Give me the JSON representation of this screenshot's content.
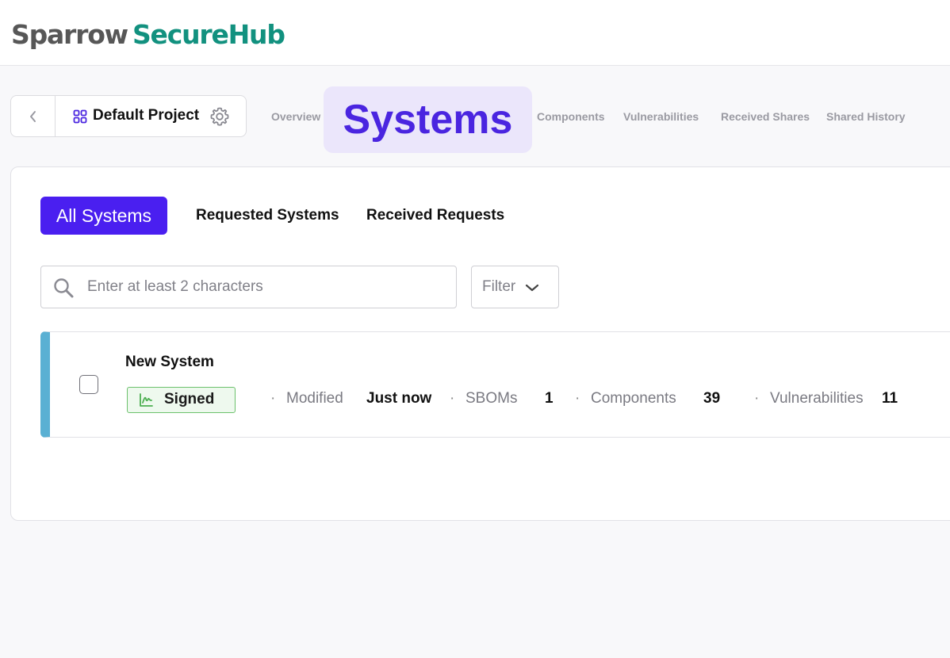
{
  "header": {
    "brand": "Sparrow",
    "product": "SecureHub"
  },
  "project": {
    "name": "Default Project"
  },
  "nav": {
    "tabs": [
      {
        "label": "Overview"
      },
      {
        "label": "Systems",
        "active": true
      },
      {
        "label": "Components"
      },
      {
        "label": "Vulnerabilities"
      },
      {
        "label": "Received Shares"
      },
      {
        "label": "Shared History"
      }
    ]
  },
  "subtabs": [
    {
      "label": "All Systems",
      "active": true
    },
    {
      "label": "Requested Systems"
    },
    {
      "label": "Received Requests"
    }
  ],
  "search": {
    "placeholder": "Enter at least 2 characters",
    "value": ""
  },
  "filter": {
    "label": "Filter"
  },
  "systems": [
    {
      "name": "New System",
      "status": "Signed",
      "modified_label": "Modified",
      "modified_value": "Just now",
      "sboms_label": "SBOMs",
      "sboms_value": "1",
      "components_label": "Components",
      "components_value": "39",
      "vulnerabilities_label": "Vulnerabilities",
      "vulnerabilities_value": "11",
      "separator": "·"
    }
  ],
  "colors": {
    "accent": "#4a1ff0",
    "brand_gray": "#575757",
    "brand_teal": "#12917f",
    "row_stripe": "#5ab0d3",
    "signed_green": "#6cc16c"
  },
  "icons": {
    "back": "chevron-left-icon",
    "project": "grid-icon",
    "settings": "gear-icon",
    "search": "search-icon",
    "filter": "chevron-down-icon",
    "signed": "signature-icon"
  }
}
